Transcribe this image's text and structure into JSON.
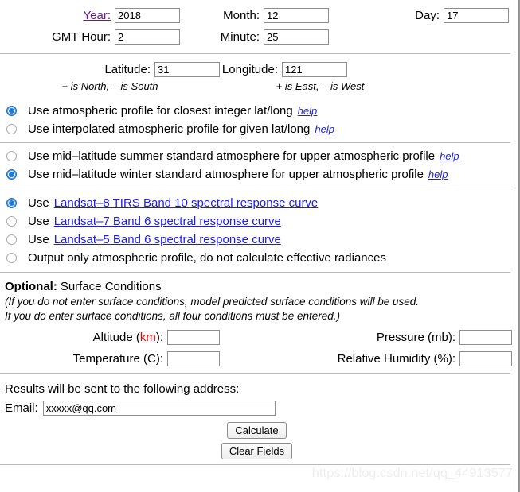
{
  "date": {
    "year_label": "Year:",
    "year_value": "2018",
    "month_label": "Month:",
    "month_value": "12",
    "day_label": "Day:",
    "day_value": "17",
    "gmt_hour_label": "GMT Hour:",
    "gmt_hour_value": "2",
    "minute_label": "Minute:",
    "minute_value": "25"
  },
  "location": {
    "latitude_label": "Latitude:",
    "latitude_value": "31",
    "latitude_hint": "+ is North, – is South",
    "longitude_label": "Longitude:",
    "longitude_value": "121",
    "longitude_hint": "+ is East, – is West"
  },
  "profile_options": [
    {
      "label": "Use atmospheric profile for closest integer lat/long",
      "help": "help",
      "selected": true
    },
    {
      "label": "Use interpolated atmospheric profile for given lat/long",
      "help": "help",
      "selected": false
    }
  ],
  "standard_atmosphere_options": [
    {
      "label": "Use mid–latitude summer standard atmosphere for upper atmospheric profile",
      "help": "help",
      "selected": false
    },
    {
      "label": "Use mid–latitude winter standard atmosphere for upper atmospheric profile",
      "help": "help",
      "selected": true
    }
  ],
  "sensor_options": [
    {
      "prefix": "Use",
      "link": "Landsat–8 TIRS Band 10 spectral response curve",
      "selected": true
    },
    {
      "prefix": "Use",
      "link": "Landsat–7 Band 6 spectral response curve",
      "selected": false
    },
    {
      "prefix": "Use",
      "link": "Landsat–5 Band 6 spectral response curve",
      "selected": false
    },
    {
      "prefix": "Output only atmospheric profile, do not calculate effective radiances",
      "link": "",
      "selected": false
    }
  ],
  "optional": {
    "title_bold": "Optional:",
    "title_rest": "Surface Conditions",
    "note_line1": "(If you do not enter surface conditions, model predicted surface conditions will be used.",
    "note_line2": "If you do enter surface conditions, all four conditions must be entered.)",
    "altitude_label_pre": "Altitude (",
    "altitude_label_unit": "km",
    "altitude_label_post": "):",
    "altitude_value": "",
    "pressure_label": "Pressure (mb):",
    "pressure_value": "",
    "temperature_label": "Temperature (C):",
    "temperature_value": "",
    "humidity_label": "Relative Humidity (%):",
    "humidity_value": ""
  },
  "email_section": {
    "intro": "Results will be sent to the following address:",
    "email_label": "Email:",
    "email_value": "xxxxx@qq.com",
    "calculate_label": "Calculate",
    "clear_label": "Clear Fields"
  },
  "watermark": "https://blog.csdn.net/qq_44913577"
}
